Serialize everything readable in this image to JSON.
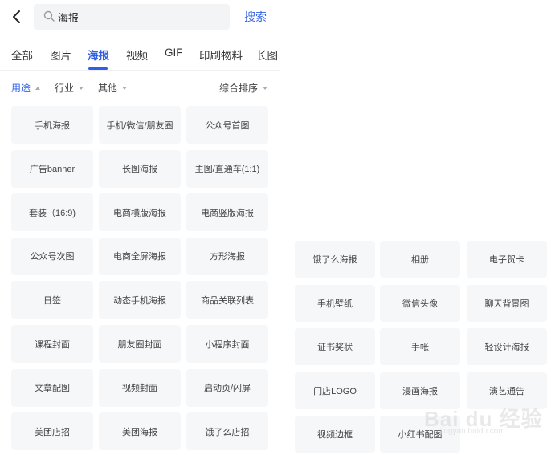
{
  "search": {
    "query": "海报",
    "button_label": "搜索"
  },
  "icons": {
    "back": "chevron-left-icon",
    "search": "magnifier-icon"
  },
  "tabs": [
    {
      "label": "全部",
      "active": false
    },
    {
      "label": "图片",
      "active": false
    },
    {
      "label": "海报",
      "active": true
    },
    {
      "label": "视频",
      "active": false
    },
    {
      "label": "GIF",
      "active": false
    },
    {
      "label": "印刷物料",
      "active": false
    },
    {
      "label": "长图",
      "active": false
    }
  ],
  "filters": {
    "usage": "用途",
    "industry": "行业",
    "other": "其他",
    "sort": "综合排序"
  },
  "left_grid": [
    "手机海报",
    "手机/微信/朋友圈",
    "公众号首图",
    "广告banner",
    "长图海报",
    "主图/直通车(1:1)",
    "套装（16:9)",
    "电商横版海报",
    "电商竖版海报",
    "公众号次图",
    "电商全屏海报",
    "方形海报",
    "日签",
    "动态手机海报",
    "商品关联列表",
    "课程封面",
    "朋友圈封面",
    "小程序封面",
    "文章配图",
    "视频封面",
    "启动页/闪屏",
    "美团店招",
    "美团海报",
    "饿了么店招"
  ],
  "right_grid": [
    "饿了么海报",
    "相册",
    "电子贺卡",
    "手机壁纸",
    "微信头像",
    "聊天背景图",
    "证书奖状",
    "手帐",
    "轻设计海报",
    "门店LOGO",
    "漫画海报",
    "演艺通告",
    "视频边框",
    "小红书配图"
  ],
  "watermark": {
    "main": "Bai du 经验",
    "sub": "jingyan.baidu.com"
  },
  "colors": {
    "accent": "#2f5fe6",
    "cell_bg": "#f6f7f9",
    "search_bg": "#f3f4f6"
  }
}
